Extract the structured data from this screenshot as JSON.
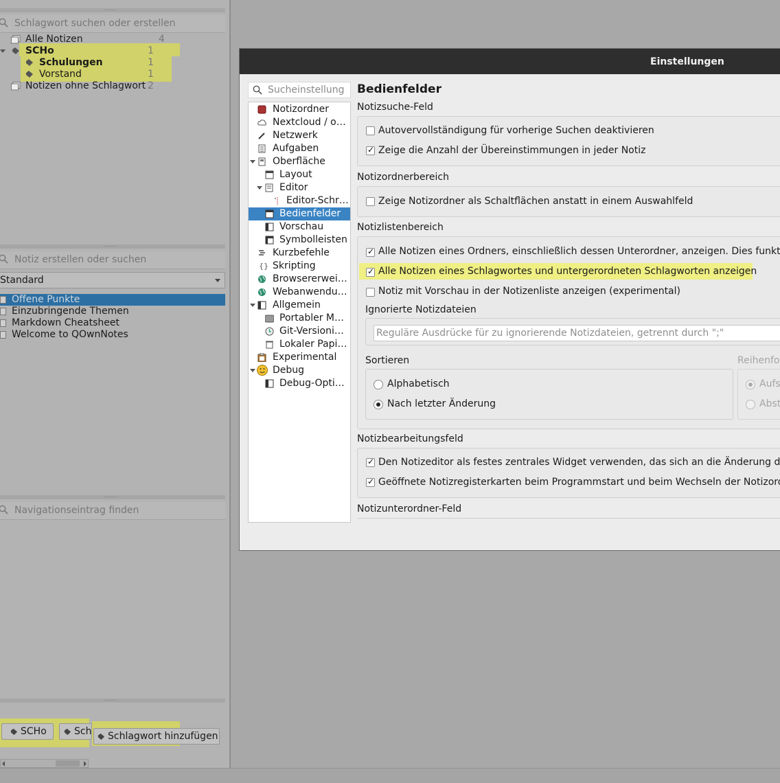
{
  "left": {
    "tag_search_placeholder": "Schlagwort suchen oder erstellen",
    "tags": [
      {
        "label": "Alle Notizen",
        "count": "4"
      },
      {
        "label": "SCHo",
        "count": "1"
      },
      {
        "label": "Schulungen",
        "count": "1"
      },
      {
        "label": "Vorstand",
        "count": "1"
      },
      {
        "label": "Notizen ohne Schlagwort",
        "count": "2"
      }
    ],
    "note_search_placeholder": "Notiz erstellen oder suchen",
    "folder_combo": "Standard",
    "notes": [
      "Offene Punkte",
      "Einzubringende Themen",
      "Markdown Cheatsheet",
      "Welcome to QOwnNotes"
    ],
    "nav_search_placeholder": "Navigationseintrag finden",
    "tag_buttons": [
      "SCHo",
      "Sch",
      "Schlagwort hinzufügen"
    ]
  },
  "dialog": {
    "title": "Einstellungen",
    "search_placeholder": "Sucheinstellung",
    "tree": [
      "Notizordner",
      "Nextcloud / o…",
      "Netzwerk",
      "Aufgaben",
      "Oberfläche",
      "Layout",
      "Editor",
      "Editor-Schr…",
      "Bedienfelder",
      "Vorschau",
      "Symbolleisten",
      "Kurzbefehle",
      "Skripting",
      "Browsererwei…",
      "Webanwendu…",
      "Allgemein",
      "Portabler M…",
      "Git-Versioni…",
      "Lokaler Papi…",
      "Experimental",
      "Debug",
      "Debug-Opti…"
    ],
    "page_title": "Bedienfelder",
    "sections": {
      "notizsuche": "Notizsuche-Feld",
      "autocomplete": "Autovervollständigung für vorherige Suchen deaktivieren",
      "show_matches": "Zeige die Anzahl der Übereinstimmungen in jeder Notiz",
      "notizordner": "Notizordnerbereich",
      "folder_buttons": "Zeige Notizordner als Schaltflächen anstatt in einem Auswahlfeld",
      "notizliste": "Notizlistenbereich",
      "all_subfolders": "Alle Notizen eines Ordners, einschließlich dessen Unterordner, anzeigen. Dies funktion",
      "all_subtags": "Alle Notizen eines Schlagwortes und untergerordneten Schlagworten anzeigen",
      "preview_in_list": "Notiz mit Vorschau in der Notizenliste anzeigen (experimental)",
      "ignored_label": "Ignorierte Notizdateien",
      "ignored_placeholder": "Reguläre Ausdrücke für zu ignorierende Notizdateien, getrennt durch \";\"",
      "sort_label": "Sortieren",
      "sort_alpha": "Alphabetisch",
      "sort_changed": "Nach letzter Änderung",
      "order_label": "Reihenfo",
      "order_asc": "Aufs",
      "order_desc": "Abst",
      "notizbearbeitung": "Notizbearbeitungsfeld",
      "central_widget": "Den Notizeditor als festes zentrales Widget verwenden, das sich an die Änderung der F",
      "restore_tabs": "Geöffnete Notizregisterkarten beim Programmstart und beim Wechseln der Notizordn",
      "unterordner": "Notizunterordner-Feld"
    }
  },
  "colors": {
    "highlight": "#d6d75c",
    "selection": "#3a84c4",
    "titlebar": "#2e2e2e"
  }
}
